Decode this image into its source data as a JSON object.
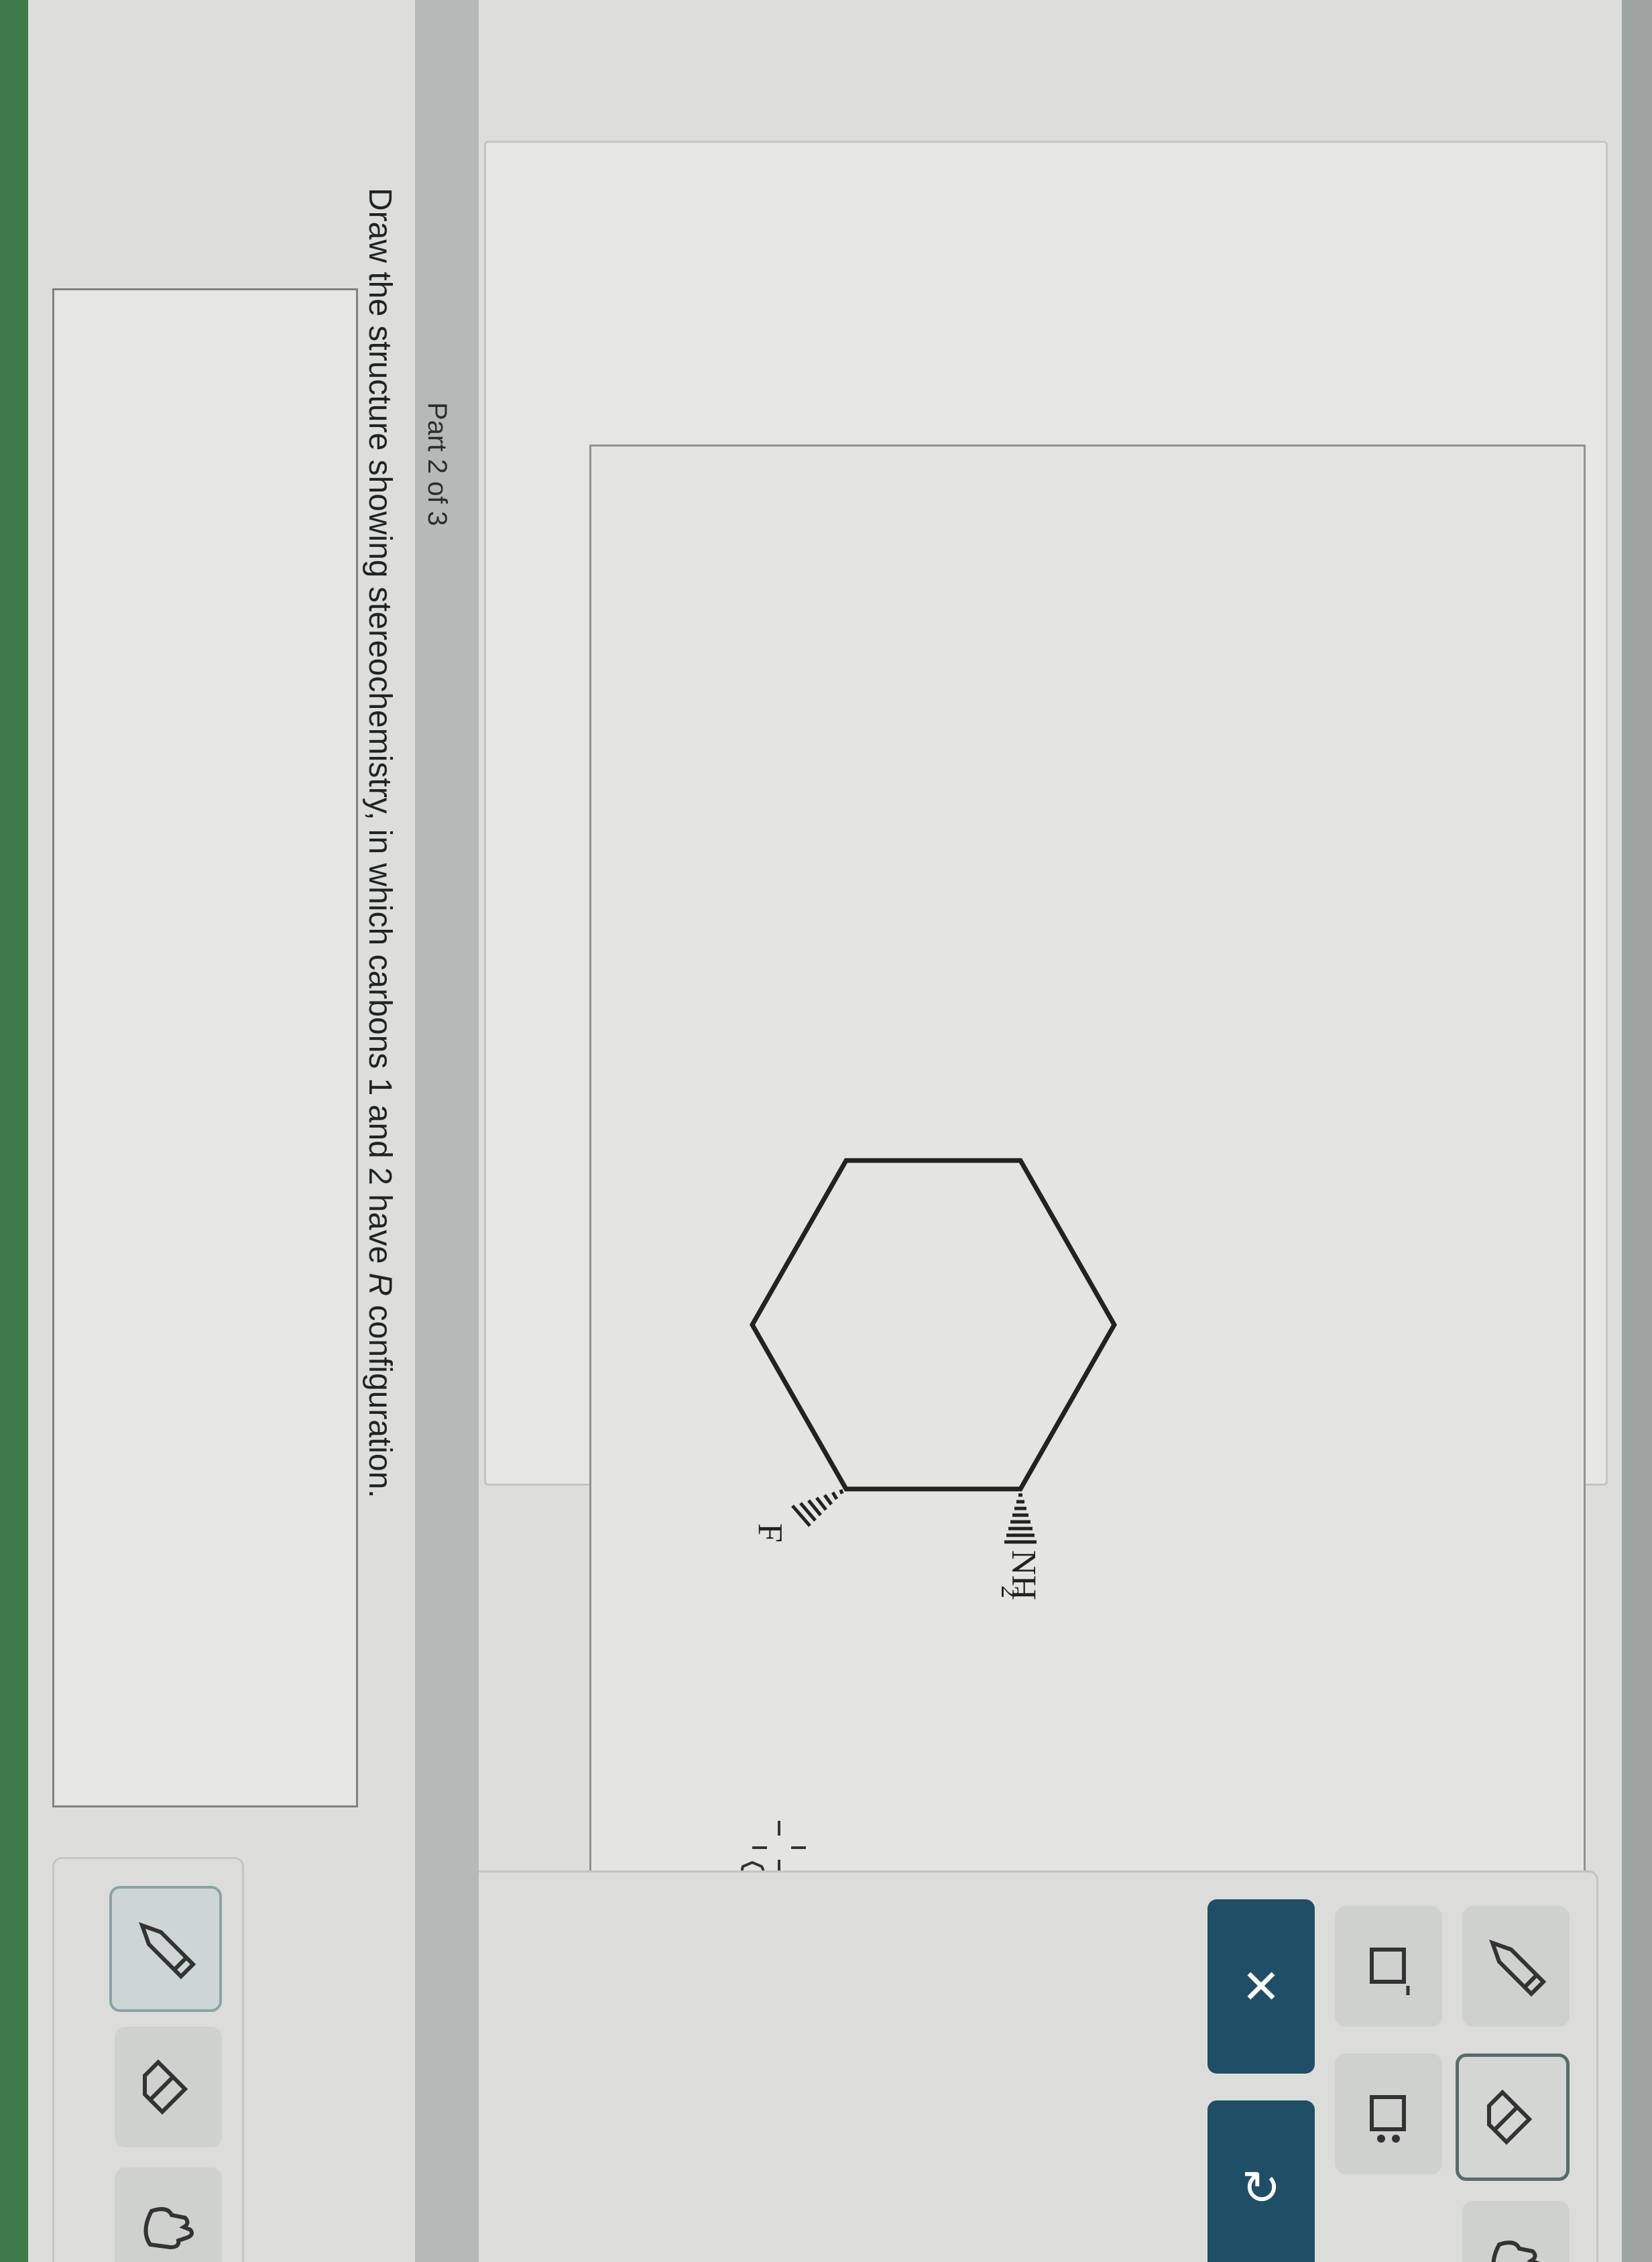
{
  "part": {
    "label": "Part 2 of 3"
  },
  "question": {
    "text_before": "Draw the structure showing stereochemistry, in which carbons 1 and 2 have ",
    "text_italic": "R",
    "text_after": " configuration."
  },
  "molecule": {
    "ring": "cyclohexane",
    "substituents": [
      {
        "label": "NH",
        "subscript": "2",
        "bond": "hashed-wedge"
      },
      {
        "label": "F",
        "subscript": "",
        "bond": "hashed-wedge"
      }
    ]
  },
  "toolbar": {
    "tools": [
      "pencil-icon",
      "eraser-icon",
      "lone-pair-icon",
      "charge-icon",
      "hand-icon"
    ],
    "actions": [
      "clear-button",
      "undo-button"
    ],
    "clear_glyph": "✕",
    "undo_glyph": "↻"
  },
  "colors": {
    "action": "#1e4f66",
    "green_frame": "#3f7a4a"
  }
}
